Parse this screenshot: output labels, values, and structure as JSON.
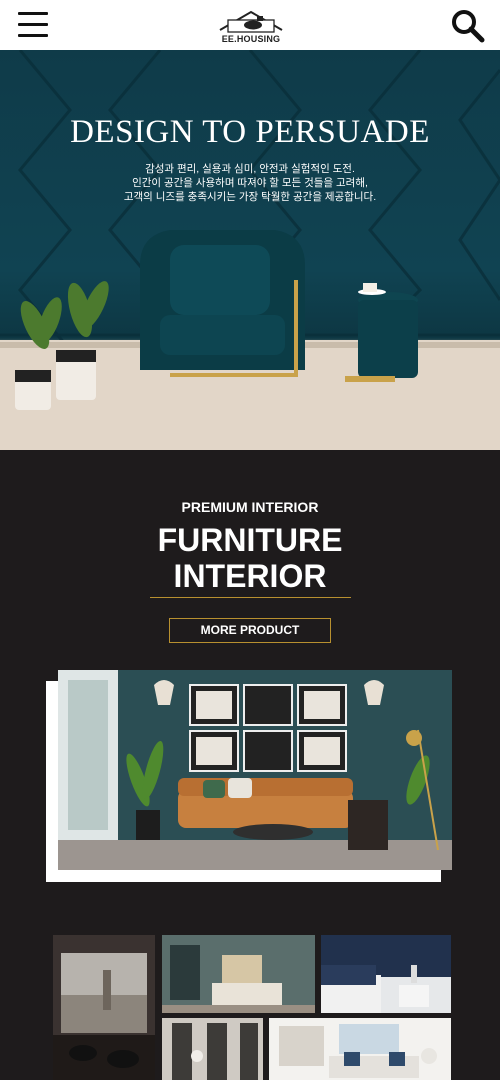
{
  "header": {
    "logo_text": "EE.HOUSING"
  },
  "hero": {
    "title": "DESIGN TO PERSUADE",
    "subtitle_lines": [
      "감성과 편리, 실용과 심미, 안전과 실험적인 도전.",
      "인간이 공간을 사용하며 따져야 할 모든 것들을 고려해,",
      "고객의 니즈를 충족시키는 가장 탁월한 공간을 제공합니다."
    ]
  },
  "intro": {
    "kicker": "PREMIUM INTERIOR",
    "headline_lines": [
      "FURNITURE",
      "INTERIOR"
    ],
    "button": "MORE PRODUCT"
  },
  "colors": {
    "accent_gold": "#b8902f",
    "dark_bg": "#1e1b1c",
    "hero_teal": "#104352"
  }
}
